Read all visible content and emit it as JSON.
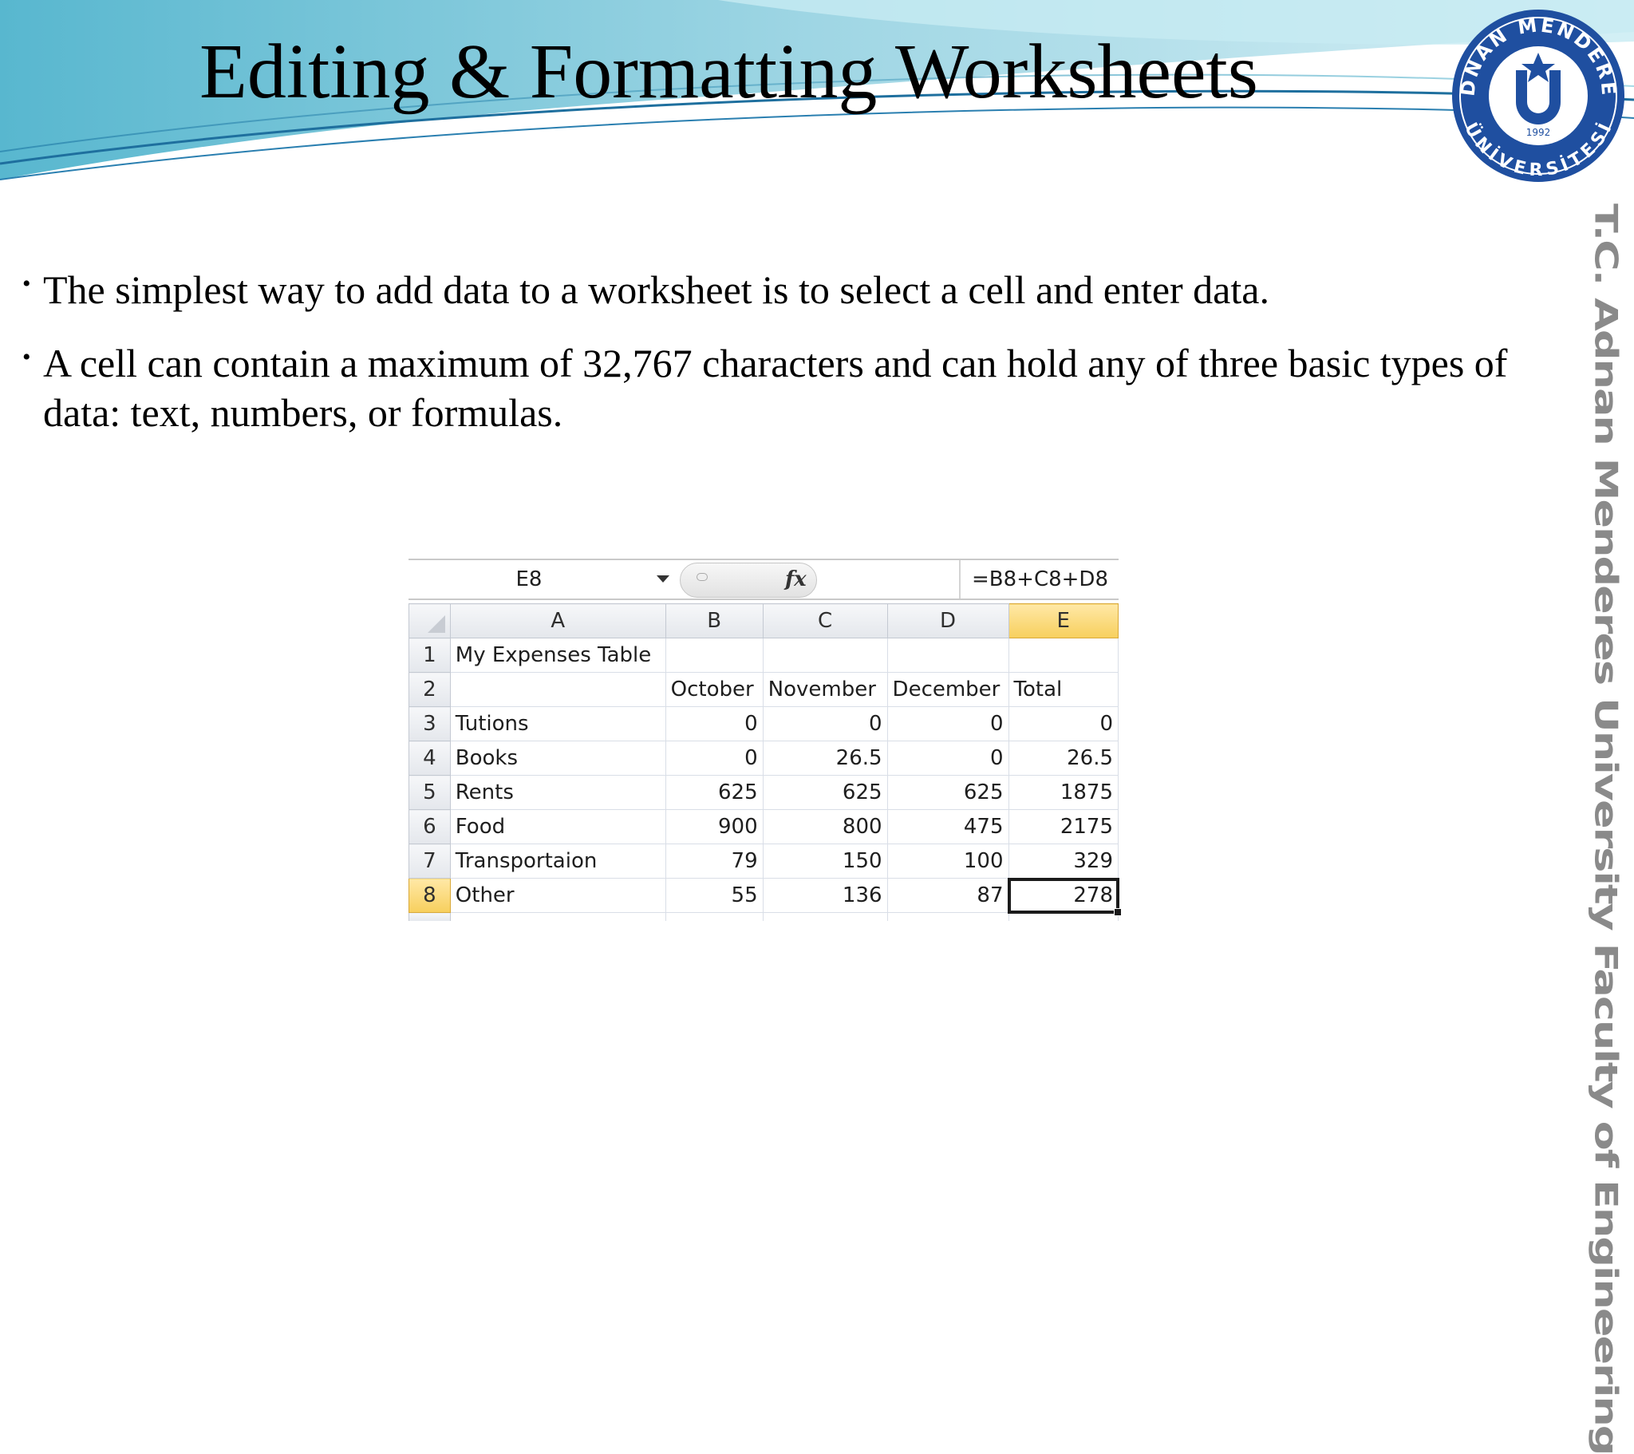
{
  "slide": {
    "title": "Editing & Formatting Worksheets",
    "side_text": "T.C.   Adnan Menderes University   Faculty of Engineering",
    "seal": {
      "top_text": "ADNAN MENDERES",
      "bottom_text": "ÜNİVERSİTESİ",
      "year": "1992",
      "colors": {
        "ring": "#1f4fa0",
        "inner": "#ffffff",
        "star": "#1f4fa0"
      }
    },
    "header_colors": {
      "light": "#bfe6ef",
      "mid": "#6cc4d8",
      "dark": "#2b7fa8"
    }
  },
  "bullets": [
    "The simplest way to add data to a worksheet is to select a cell and enter data.",
    "A cell can contain a maximum of 32,767 characters and can hold any of three basic types of data: text, numbers, or formulas."
  ],
  "spreadsheet": {
    "name_box": "E8",
    "fx": "fx",
    "formula": "=B8+C8+D8",
    "columns": [
      "A",
      "B",
      "C",
      "D",
      "E"
    ],
    "active_column": "E",
    "active_row": "8",
    "rows": [
      {
        "num": "1",
        "cells": [
          "My Expenses Table",
          "",
          "",
          "",
          ""
        ]
      },
      {
        "num": "2",
        "cells": [
          "",
          "October",
          "November",
          "December",
          "Total"
        ]
      },
      {
        "num": "3",
        "cells": [
          "Tutions",
          "0",
          "0",
          "0",
          "0"
        ]
      },
      {
        "num": "4",
        "cells": [
          "Books",
          "0",
          "26.5",
          "0",
          "26.5"
        ]
      },
      {
        "num": "5",
        "cells": [
          "Rents",
          "625",
          "625",
          "625",
          "1875"
        ]
      },
      {
        "num": "6",
        "cells": [
          "Food",
          "900",
          "800",
          "475",
          "2175"
        ]
      },
      {
        "num": "7",
        "cells": [
          "Transportaion",
          "79",
          "150",
          "100",
          "329"
        ]
      },
      {
        "num": "8",
        "cells": [
          "Other",
          "55",
          "136",
          "87",
          "278"
        ]
      }
    ]
  }
}
